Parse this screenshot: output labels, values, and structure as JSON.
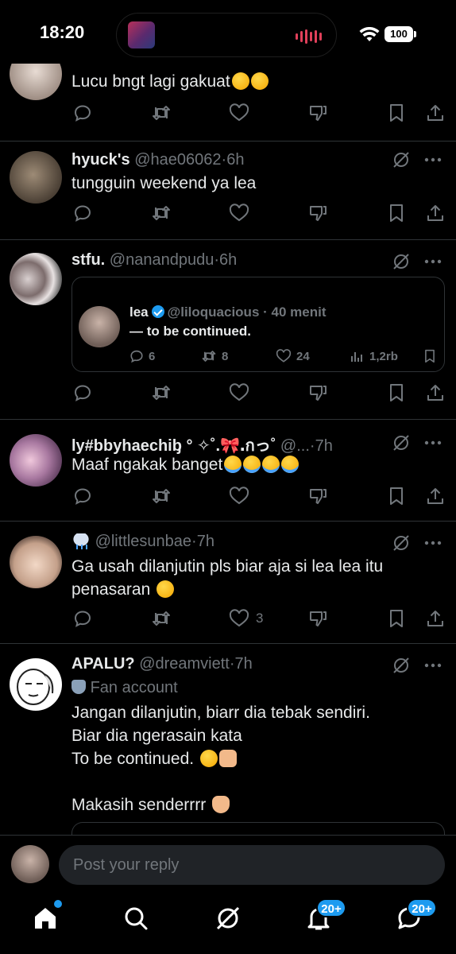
{
  "status_bar": {
    "time": "18:20",
    "battery": "100"
  },
  "tweets": [
    {
      "name": "",
      "handle": "",
      "time": "",
      "text": "Lucu bngt lagi gakuat",
      "likes": ""
    },
    {
      "name": "hyuck's",
      "handle": "@hae06062",
      "time": "6h",
      "text": "tungguin weekend ya lea",
      "likes": ""
    },
    {
      "name": "stfu.",
      "handle": "@nanandpudu",
      "time": "6h",
      "text": "",
      "likes": ""
    },
    {
      "name": "ly#bbyhaechiᶀ ° ✧˚.🎀․กっ˚",
      "handle": "@...",
      "time": "7h",
      "text": "Maaf ngakak banget",
      "likes": ""
    },
    {
      "name": "",
      "handle": "@littlesunbae",
      "time": "7h",
      "text": "Ga usah dilanjutin pls biar aja si lea lea itu penasaran",
      "likes": "3"
    },
    {
      "name": "APALU?",
      "handle": "@dreamviett",
      "time": "7h",
      "label": "Fan account",
      "text_lines": [
        "Jangan dilanjutin, biarr dia tebak sendiri.",
        "Biar dia ngerasain kata",
        "To be continued.",
        "",
        "Makasih senderrrr"
      ]
    }
  ],
  "quote": {
    "name": "lea",
    "handle": "@liloquacious",
    "time": "40 menit",
    "text": "— to be continued.",
    "replies": "6",
    "reposts": "8",
    "likes": "24",
    "views": "1,2rb"
  },
  "reply": {
    "placeholder": "Post your reply"
  },
  "nav": {
    "notif_badge": "20+",
    "messages_badge": "20+"
  },
  "colors": {
    "accent": "#1d9bf0",
    "muted": "#71767b",
    "divider": "#2f3336"
  },
  "icons": [
    "reply-icon",
    "repost-icon",
    "like-icon",
    "dislike-icon",
    "bookmark-icon",
    "share-icon",
    "grok-icon",
    "more-icon",
    "home-icon",
    "search-icon",
    "notifications-icon",
    "messages-icon"
  ]
}
